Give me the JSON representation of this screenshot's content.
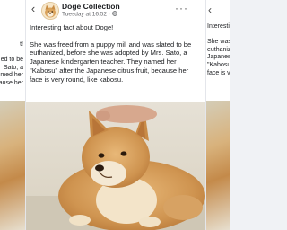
{
  "post": {
    "page_name": "Doge Collection",
    "timestamp": "Tuesday at 16:52 · ",
    "intro": "Interesting fact about Doge!",
    "body": "She was freed from a puppy mill and was slated to be euthanized, before she was adopted by Mrs. Sato, a Japanese kindergarten teacher. They named her \"Kabosu\" after the Japanese citrus fruit, because her face is very round, like kabosu.",
    "more_label": "···"
  },
  "ghost_left": {
    "lines": [
      "t!",
      "",
      "ed to be",
      "Sato, a",
      "med her",
      "ecause her"
    ]
  },
  "ghost_right": {
    "back_icon": "‹",
    "lines": [
      "Interesting",
      "",
      "She was fr",
      "euthanized",
      "Japanese",
      "\"Kabosu\" a",
      "face is ver"
    ]
  },
  "icons": {
    "back": "chevron-left-icon",
    "avatar": "doge-avatar-icon",
    "globe": "globe-icon"
  },
  "colors": {
    "text": "#1c1e21",
    "secondary": "#65676b",
    "background": "#ffffff"
  }
}
